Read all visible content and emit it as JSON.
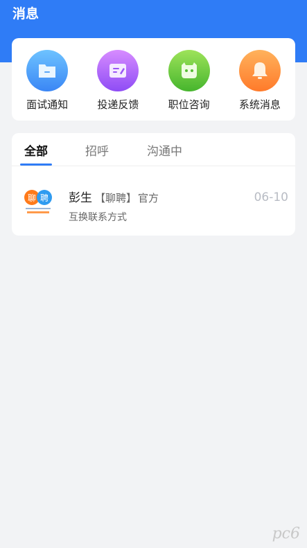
{
  "header": {
    "title": "消息"
  },
  "quick_actions": [
    {
      "label": "面试通知",
      "icon": "folder-icon",
      "color_top": "#6ec3ff",
      "color_bottom": "#3a86f5"
    },
    {
      "label": "投递反馈",
      "icon": "feedback-icon",
      "color_top": "#d78cff",
      "color_bottom": "#8e4cf5"
    },
    {
      "label": "职位咨询",
      "icon": "chat-face-icon",
      "color_top": "#9ee35a",
      "color_bottom": "#46b52d"
    },
    {
      "label": "系统消息",
      "icon": "bell-icon",
      "color_top": "#ffb25c",
      "color_bottom": "#ff7a2a"
    }
  ],
  "tabs": [
    {
      "label": "全部",
      "active": true
    },
    {
      "label": "招呼",
      "active": false
    },
    {
      "label": "沟通中",
      "active": false
    }
  ],
  "messages": [
    {
      "sender": "彭生",
      "tag": "【聊聘】",
      "official": "官方",
      "preview": "互换联系方式",
      "date": "06-10",
      "avatar": {
        "text_1": "聊",
        "text_2": "聘",
        "color_1": "#ff7a1a",
        "color_2": "#2f9bf0"
      }
    }
  ],
  "watermark": "pc6"
}
